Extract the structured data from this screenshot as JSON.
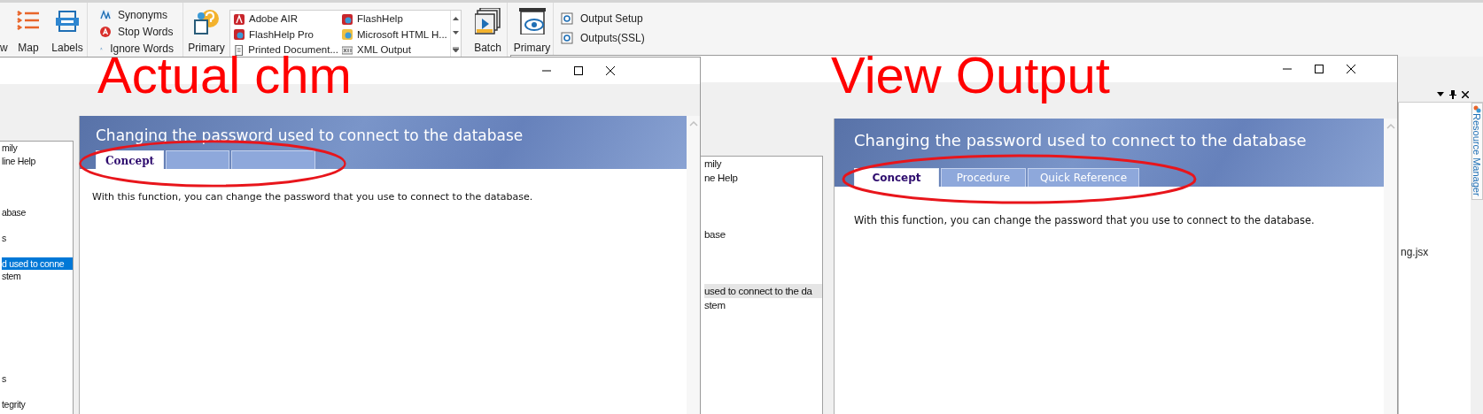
{
  "ribbon": {
    "large_buttons": [
      {
        "kind": "cut",
        "label": "w"
      },
      {
        "kind": "map",
        "label": "Map"
      },
      {
        "kind": "labels",
        "label": "Labels"
      }
    ],
    "small_buttons": [
      {
        "kind": "synonyms",
        "label": "Synonyms"
      },
      {
        "kind": "stop",
        "label": "Stop Words"
      },
      {
        "kind": "ignore",
        "label": "Ignore Words"
      }
    ],
    "primary_button": {
      "label": "Primary"
    },
    "output_gallery": [
      {
        "kind": "air",
        "label": "Adobe AIR"
      },
      {
        "kind": "flashhelp",
        "label": "FlashHelp Pro"
      },
      {
        "kind": "print",
        "label": "Printed Document..."
      },
      {
        "kind": "flashhelp",
        "label": "FlashHelp"
      },
      {
        "kind": "chm",
        "label": "Microsoft HTML H..."
      },
      {
        "kind": "xml",
        "label": "XML Output"
      }
    ],
    "batch_button": {
      "label": "Batch"
    },
    "view_button": {
      "label": "Primary"
    },
    "output_buttons": [
      {
        "label": "Output Setup"
      },
      {
        "label": "Outputs(SSL)"
      }
    ]
  },
  "background_panel": {
    "file_label": "ng.jsx",
    "side_tab": "Resource Manager"
  },
  "windows": [
    {
      "kind": "chm",
      "annotation": "Actual chm",
      "nav_items": [
        {
          "label": "mily",
          "selected": false
        },
        {
          "label": "line Help",
          "selected": false
        },
        {
          "label": "abase",
          "selected": false
        },
        {
          "label": "s",
          "selected": false
        },
        {
          "label": "d used to conne",
          "selected": true
        },
        {
          "label": "stem",
          "selected": false
        },
        {
          "label": "s",
          "selected": false
        },
        {
          "label": "tegrity",
          "selected": false
        }
      ],
      "topic": {
        "title": "Changing the password used to connect to the database",
        "tabs": [
          {
            "label": "Concept",
            "selected": true
          },
          {
            "selected": false
          },
          {
            "selected": false
          }
        ],
        "body": "With this function, you can change the password that you use to connect to the database."
      }
    },
    {
      "kind": "preview",
      "annotation": "View Output",
      "nav_items": [
        {
          "label": "mily",
          "selected": false
        },
        {
          "label": "ne Help",
          "selected": false
        },
        {
          "label": "base",
          "selected": false
        },
        {
          "label": "used to connect to the da",
          "selected": true
        },
        {
          "label": "stem",
          "selected": false
        }
      ],
      "topic": {
        "title": "Changing the password used to connect to the database",
        "tabs": [
          {
            "label": "Concept",
            "selected": true
          },
          {
            "label": "Procedure",
            "selected": false
          },
          {
            "label": "Quick Reference",
            "selected": false
          }
        ],
        "body": "With this function, you can change the password that you use to connect to the database."
      }
    }
  ]
}
